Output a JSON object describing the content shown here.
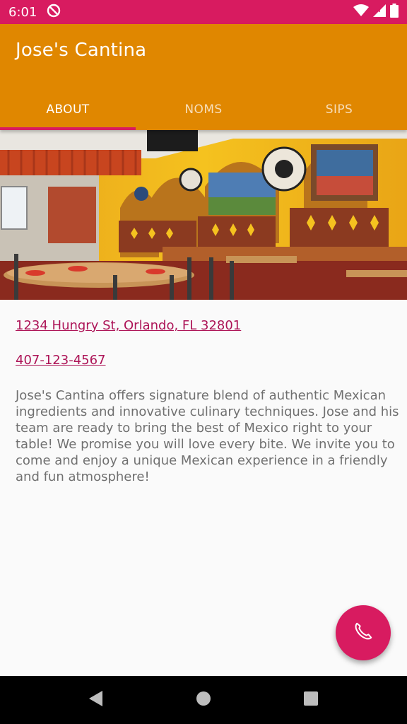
{
  "status_bar": {
    "time": "6:01",
    "icons": [
      "do-not-disturb-icon",
      "wifi-icon",
      "cell-signal-icon",
      "battery-icon"
    ],
    "color": "#d81b60"
  },
  "app_bar": {
    "title": "Jose's Cantina",
    "color": "#e08700"
  },
  "tabs": [
    {
      "label": "ABOUT",
      "active": true
    },
    {
      "label": "NOMS",
      "active": false
    },
    {
      "label": "SIPS",
      "active": false
    }
  ],
  "hero_image": {
    "subject": "restaurant-interior-photo"
  },
  "content": {
    "address": "1234 Hungry St, Orlando, FL 32801",
    "phone": "407-123-4567",
    "description": "Jose's Cantina offers signature blend of authentic Mexican ingredients and innovative culinary techniques. Jose and his team are ready to bring the best of Mexico right to your table! We promise you will love every bite. We invite you to come and enjoy a unique Mexican experience in a friendly and fun atmosphere!"
  },
  "fab": {
    "icon": "phone-icon",
    "color": "#d81b60"
  },
  "nav_bar": {
    "buttons": [
      "back-icon",
      "home-icon",
      "recents-icon"
    ]
  }
}
